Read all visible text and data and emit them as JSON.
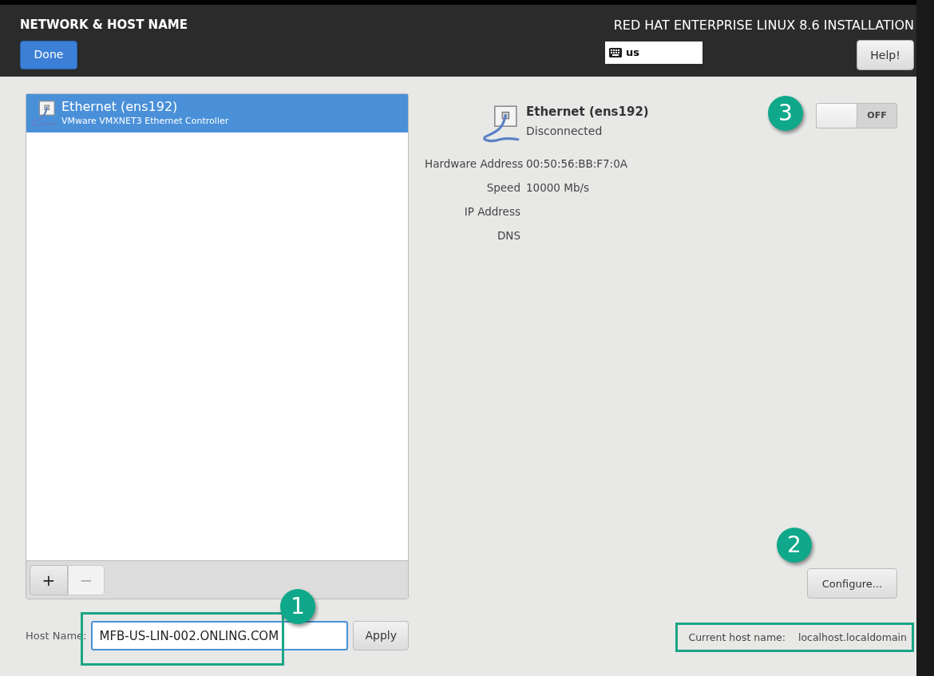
{
  "header": {
    "title": "NETWORK & HOST NAME",
    "done_button": "Done",
    "product_title": "RED HAT ENTERPRISE LINUX 8.6 INSTALLATION",
    "keyboard_layout": "us",
    "help_button": "Help!"
  },
  "devices": [
    {
      "name": "Ethernet (ens192)",
      "description": "VMware VMXNET3 Ethernet Controller",
      "selected": true
    }
  ],
  "list_toolbar": {
    "add": "+",
    "remove": "−"
  },
  "detail": {
    "name": "Ethernet (ens192)",
    "status": "Disconnected",
    "switch_label": "OFF",
    "on": false,
    "properties": [
      {
        "label": "Hardware Address",
        "value": "00:50:56:BB:F7:0A"
      },
      {
        "label": "Speed",
        "value": "10000 Mb/s"
      },
      {
        "label": "IP Address"
      },
      {
        "label": "DNS"
      }
    ],
    "configure_button": "Configure..."
  },
  "host_name": {
    "label": "Host Name:",
    "value": "MFB-US-LIN-002.ONLING.COM",
    "apply_button": "Apply",
    "current_label": "Current host name:",
    "current_value": "localhost.localdomain"
  },
  "callouts": [
    "1",
    "2",
    "3"
  ]
}
